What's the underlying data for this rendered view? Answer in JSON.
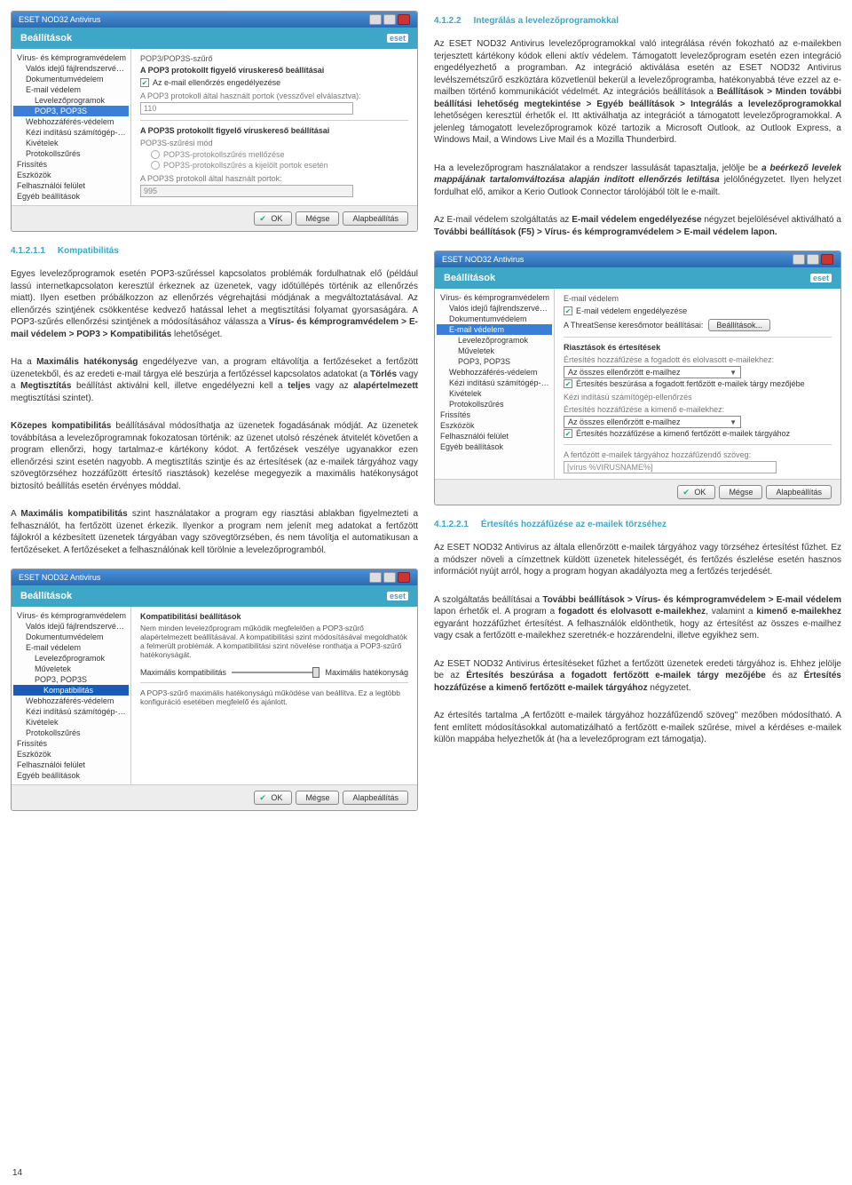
{
  "page_num": "14",
  "ss_common": {
    "titlebar": "ESET NOD32 Antivirus",
    "header": "Beállítások",
    "logo": "eset",
    "btn_ok": "OK",
    "btn_cancel": "Mégse",
    "btn_default": "Alapbeállítás"
  },
  "tree": {
    "root": "Vírus- és kémprogramvédelem",
    "t1": "Valós idejű fájlrendszervédelem",
    "t2": "Dokumentumvédelem",
    "t3": "E-mail védelem",
    "t3a": "Levelezőprogramok",
    "t3b": "Műveletek",
    "t3c": "POP3, POP3S",
    "t3c1": "Kompatibilitás",
    "t4": "Webhozzáférés-védelem",
    "t5": "Kézi indítású számítógép-ellenőrzés",
    "t6": "Kivételek",
    "t7": "Protokollszűrés",
    "r2": "Frissítés",
    "r3": "Eszközök",
    "r4": "Felhasználói felület",
    "r5": "Egyéb beállítások"
  },
  "ss1": {
    "crumb": "POP3/POP3S-szűrő",
    "group1": "A POP3 protokollt figyelő víruskereső beállításai",
    "chk1": "Az e-mail ellenőrzés engedélyezése",
    "lbl_ports": "A POP3 protokoll által használt portok (vesszővel elválasztva):",
    "val_ports": "110",
    "group2": "A POP3S protokollt figyelő víruskereső beállításai",
    "lbl_mode": "POP3S-szűrési mód",
    "rad1": "POP3S-protokollszűrés mellőzése",
    "rad2": "POP3S-protokollszűrés a kijelölt portok esetén",
    "lbl_ports2": "A POP3S protokoll által használt portok:",
    "val_ports2": "995"
  },
  "ss2": {
    "title": "Kompatibilitási beállítások",
    "desc": "Nem minden levelezőprogram működik megfelelően a POP3-szűrő alapértelmezett beállításával. A kompatibilitási szint módosításával megoldhatók a felmerült problémák. A kompatibilitási szint növelése ronthatja a POP3-szűrő hatékonyságát.",
    "left": "Maximális kompatibilitás",
    "right": "Maximális hatékonyság",
    "footnote": "A POP3-szűrő maximális hatékonyságú működése van beállítva. Ez a legtöbb konfiguráció esetében megfelelő és ajánlott."
  },
  "ss3": {
    "crumb": "E-mail védelem",
    "chk_enable": "E-mail védelem engedélyezése",
    "lbl_threat": "A ThreatSense keresőmotor beállításai:",
    "btn_settings": "Beállítások...",
    "grp_ri": "Riasztások és értesítések",
    "lbl_add_recv": "Értesítés hozzáfűzése a fogadott és elolvasott e-mailekhez:",
    "dd1": "Az összes ellenőrzött e-mailhez",
    "chk_subj_recv": "Értesítés beszúrása a fogadott fertőzött e-mailek tárgy mezőjébe",
    "lbl_launch": "Kézi indítású számítógép-ellenőrzés",
    "lbl_add_sent": "Értesítés hozzáfűzése a kimenő e-mailekhez:",
    "dd2": "Az összes ellenőrzött e-mailhez",
    "chk_subj_sent": "Értesítés hozzáfűzése a kimenő fertőzött e-mailek tárgyához",
    "lbl_tag": "A fertőzött e-mailek tárgyához hozzáfűzendő szöveg:",
    "val_tag": "[vírus %VIRUSNAME%]"
  },
  "left_col": {
    "h41211_num": "4.1.2.1.1",
    "h41211_title": "Kompatibilitás",
    "p_intro": "Egyes levelezőprogramok esetén POP3-szűréssel kapcsolatos problémák fordulhatnak elő (például lassú internetkapcsolaton keresztül érkeznek az üzenetek, vagy időtúllépés történik az ellenőrzés miatt). Ilyen esetben próbálkozzon az ellenőrzés végrehajtási módjának a megváltoztatásával. Az ellenőrzés szintjének csökkentése kedvező hatással lehet a megtisztítási folyamat gyorsaságára. A POP3-szűrés ellenőrzési szintjének a módosításához válassza a ",
    "p_intro_b": "Vírus- és kémprogramvédelem > E-mail védelem > POP3 > Kompatibilitás",
    "p_intro_end": " lehetőséget.",
    "p_max1_a": "Ha a ",
    "p_max1_b": "Maximális hatékonyság",
    "p_max1_c": " engedélyezve van, a program eltávolítja a fertőzéseket a fertőzött üzenetekből, és az eredeti e-mail tárgya elé beszúrja a fertőzéssel kapcsolatos adatokat (a ",
    "p_max1_d": "Törlés",
    "p_max1_e": " vagy a ",
    "p_max1_f": "Megtisztítás",
    "p_max1_g": " beállítást aktiválni kell, illetve engedélyezni kell a ",
    "p_max1_h": "teljes",
    "p_max1_i": " vagy az ",
    "p_max1_j": "alapértelmezett",
    "p_max1_k": " megtisztítási szintet).",
    "p_med_a": "Közepes kompatibilitás",
    "p_med_b": " beállításával módosíthatja az üzenetek fogadásának módját. Az üzenetek továbbítása a levelezőprogramnak fokozatosan történik: az üzenet utolsó részének átvitelét követően a program ellenőrzi, hogy tartalmaz-e kártékony kódot. A fertőzések veszélye ugyanakkor ezen ellenőrzési szint esetén nagyobb. A megtisztítás szintje és az értesítések (az e-mailek tárgyához vagy szövegtörzséhez hozzáfűzött értesítő riasztások) kezelése megegyezik a maximális hatékonyságot biztosító beállítás esetén érvényes móddal.",
    "p_maxc_a": "A ",
    "p_maxc_b": "Maximális kompatibilitás",
    "p_maxc_c": " szint használatakor a program egy riasztási ablakban figyelmezteti a felhasználót, ha fertőzött üzenet érkezik. Ilyenkor a program nem jelenít meg adatokat a fertőzött fájlokról a kézbesített üzenetek tárgyában vagy szövegtörzsében, és nem távolítja el automatikusan a fertőzéseket. A fertőzéseket a felhasználónak kell törölnie a levelezőprogramból."
  },
  "right_col": {
    "h4122_num": "4.1.2.2",
    "h4122_title": "Integrálás a levelezőprogramokkal",
    "p1_a": "Az ESET NOD32 Antivirus levelezőprogramokkal való integrálása révén fokozható az e-mailekben terjesztett kártékony kódok elleni aktív védelem. Támogatott levelezőprogram esetén ezen integráció engedélyezhető a programban. Az integráció aktiválása esetén az ESET NOD32 Antivirus levélszemétszűrő eszköztára közvetlenül bekerül a levelezőprogramba, hatékonyabbá téve ezzel az e-mailben történő kommunikációt védelmét. Az integrációs beállítások a ",
    "p1_b": "Beállítások > Minden további beállítási lehetőség megtekintése > Egyéb beállítások > Integrálás a levelezőprogramokkal",
    "p1_c": " lehetőségen keresztül érhetők el. Itt aktiválhatja az integrációt a támogatott levelezőprogramokkal. A jelenleg támogatott levelezőprogramok közé tartozik a Microsoft Outlook, az Outlook Express, a Windows Mail, a Windows Live Mail és a Mozilla Thunderbird.",
    "p2_a": "Ha a levelezőprogram használatakor a rendszer lassulását tapasztalja, jelölje be ",
    "p2_b": "a beérkező levelek mappájának tartalomváltozása alapján indított ellenőrzés letiltása",
    "p2_c": " jelölőnégyzetet. Ilyen helyzet fordulhat elő, amikor a Kerio Outlook Connector tárolójából tölt le e-mailt.",
    "p3_a": "Az E-mail védelem szolgáltatás az ",
    "p3_b": "E-mail védelem engedélyezése",
    "p3_c": " négyzet bejelölésével aktiválható a ",
    "p3_d": "További beállítások (F5) > Vírus- és kémprogramvédelem > E-mail védelem lapon.",
    "h41221_num": "4.1.2.2.1",
    "h41221_title": "Értesítés hozzáfűzése az e-mailek törzséhez",
    "p4": "Az ESET NOD32 Antivirus az általa ellenőrzött e-mailek tárgyához vagy törzséhez értesítést fűzhet. Ez a módszer növeli a címzettnek küldött üzenetek hitelességét, és fertőzés észlelése esetén hasznos információt nyújt arról, hogy a program hogyan akadályozta meg a fertőzés terjedését.",
    "p5_a": "A szolgáltatás beállításai a ",
    "p5_b": "További beállítások > Vírus- és kémprogramvédelem > E-mail védelem",
    "p5_c": " lapon érhetők el. A program a ",
    "p5_d": "fogadott és elolvasott e-mailekhez",
    "p5_e": ", valamint a ",
    "p5_f": "kimenő e-mailekhez",
    "p5_g": " egyaránt hozzáfűzhet értesítést. A felhasználók eldönthetik, hogy az értesítést az összes e-mailhez vagy csak a fertőzött e-mailekhez szeretnék-e hozzárendelni, illetve egyikhez sem.",
    "p6_a": "Az ESET NOD32 Antivirus értesítéseket fűzhet a fertőzött üzenetek eredeti tárgyához is. Ehhez jelölje be az ",
    "p6_b": "Értesítés beszúrása a fogadott fertőzött e-mailek tárgy mezőjébe",
    "p6_c": " és az ",
    "p6_d": "Értesítés hozzáfűzése a kimenő fertőzött e-mailek tárgyához",
    "p6_e": " négyzetet.",
    "p7": "Az értesítés tartalma „A fertőzött e-mailek tárgyához hozzáfűzendő szöveg\" mezőben módosítható. A fent említett módosításokkal automatizálható a fertőzött e-mailek szűrése, mivel a kérdéses e-mailek külön mappába helyezhetők át (ha a levelezőprogram ezt támogatja)."
  }
}
